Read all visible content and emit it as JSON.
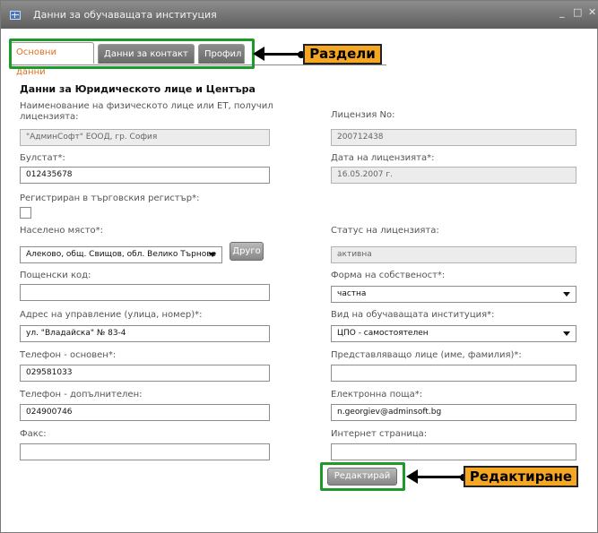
{
  "window": {
    "title": "Данни за обучаващата институция",
    "controls": {
      "minimize": "_",
      "maximize": "□",
      "close": "✕"
    }
  },
  "tabs": [
    {
      "label": "Основни данни",
      "active": true
    },
    {
      "label": "Данни за контакт",
      "active": false
    },
    {
      "label": "Профил",
      "active": false
    }
  ],
  "annotations": {
    "sections_label": "Раздели",
    "edit_label": "Редактиране",
    "highlight_color": "#1d9a2a",
    "callout_color": "#f5a623"
  },
  "form": {
    "section_title": "Данни за Юридическото лице и Центъра",
    "person_name": {
      "label": "Наименование на физическото лице или ЕТ, получил лицензията:",
      "value": "\"АдминСофт\" ЕООД, гр. София"
    },
    "license_no": {
      "label": "Лицензия No:",
      "value": "200712438"
    },
    "bulstat": {
      "label": "Булстат*:",
      "value": "012435678"
    },
    "license_date": {
      "label": "Дата на лицензията*:",
      "value": "16.05.2007 г."
    },
    "registered": {
      "label": "Регистриран в търговския регистър*:",
      "checked": false
    },
    "settlement": {
      "label": "Населено място*:",
      "value": "Алеково, общ. Свищов, обл. Велико Търново",
      "other_button": "Друго"
    },
    "license_status": {
      "label": "Статус на лицензията:",
      "value": "активна"
    },
    "postal_code": {
      "label": "Пощенски код:",
      "value": ""
    },
    "ownership": {
      "label": "Форма на собственост*:",
      "value": "частна"
    },
    "address": {
      "label": "Адрес на управление (улица, номер)*:",
      "value": "ул. \"Владайска\" № 83-4"
    },
    "institution_type": {
      "label": "Вид на обучаващата институция*:",
      "value": "ЦПО - самостоятелен"
    },
    "phone_main": {
      "label": "Телефон - основен*:",
      "value": "029581033"
    },
    "representative": {
      "label": "Представляващо лице (име, фамилия)*:",
      "value": ""
    },
    "phone_extra": {
      "label": "Телефон - допълнителен:",
      "value": "024900746"
    },
    "email": {
      "label": "Електронна поща*:",
      "value": "n.georgiev@adminsoft.bg"
    },
    "fax": {
      "label": "Факс:",
      "value": ""
    },
    "website": {
      "label": "Интернет страница:",
      "value": ""
    },
    "edit_button": "Редактирай"
  }
}
